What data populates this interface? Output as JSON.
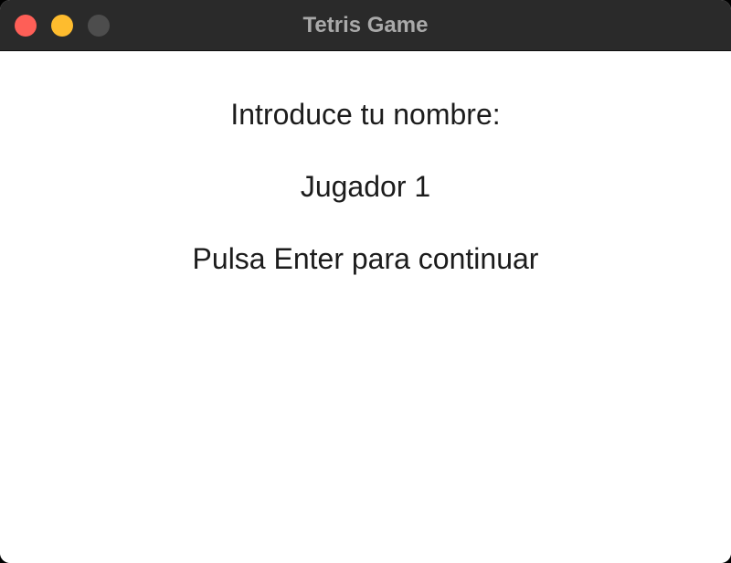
{
  "window": {
    "title": "Tetris Game",
    "controls": {
      "close": "close-icon",
      "minimize": "minimize-icon",
      "zoom": "zoom-icon"
    }
  },
  "screen": {
    "prompt": "Introduce tu nombre:",
    "name_value": "Jugador 1",
    "hint": "Pulsa Enter para continuar"
  },
  "colors": {
    "titlebar": "#2a2a2a",
    "close": "#fe5f57",
    "minimize": "#febc2e",
    "zoom": "#4d4d4d",
    "background": "#ffffff",
    "text": "#1c1c1c"
  }
}
